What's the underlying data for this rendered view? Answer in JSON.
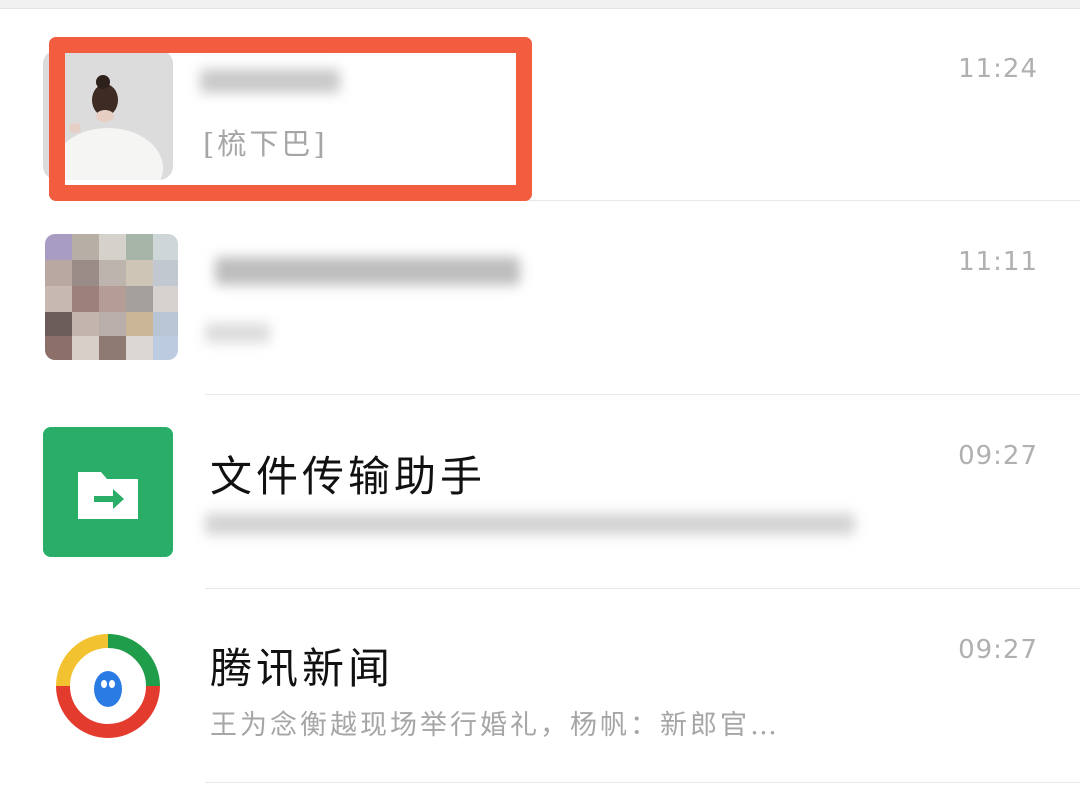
{
  "chats": [
    {
      "name": "",
      "preview": "[梳下巴]",
      "time": "11:24",
      "avatar_icon": "photo-avatar-woman",
      "highlighted": true,
      "highlight_color": "#f25c3f"
    },
    {
      "name": "",
      "preview": "",
      "time": "11:11",
      "avatar_icon": "group-avatar-grid"
    },
    {
      "name": "文件传输助手",
      "preview": "",
      "time": "09:27",
      "avatar_icon": "file-transfer-icon",
      "avatar_color": "#2aae67"
    },
    {
      "name": "腾讯新闻",
      "preview": "王为念衡越现场举行婚礼，杨帆：新郎官…",
      "time": "09:27",
      "avatar_icon": "tencent-news-logo"
    }
  ]
}
